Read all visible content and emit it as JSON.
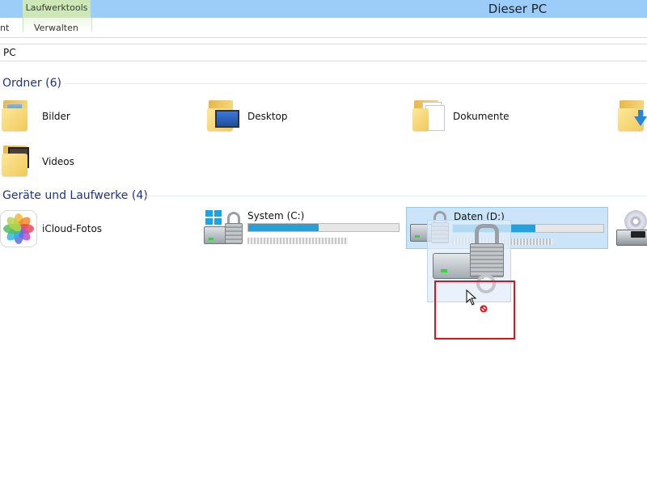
{
  "titlebar": {
    "context_tab_header": "Laufwerktools",
    "title": "Dieser PC"
  },
  "ribbon": {
    "tabs": [
      {
        "label": "nt"
      },
      {
        "label": "Verwalten"
      }
    ]
  },
  "address": {
    "path": "PC"
  },
  "groups": {
    "folders": {
      "header": "Ordner (6)",
      "items": [
        {
          "label": "Bilder",
          "icon": "pictures-folder-icon"
        },
        {
          "label": "Desktop",
          "icon": "desktop-folder-icon"
        },
        {
          "label": "Dokumente",
          "icon": "documents-folder-icon"
        },
        {
          "label": "",
          "icon": "downloads-folder-icon"
        },
        {
          "label": "Videos",
          "icon": "videos-folder-icon"
        }
      ]
    },
    "devices": {
      "header": "Geräte und Laufwerke (4)",
      "items": [
        {
          "label": "iCloud-Fotos",
          "icon": "icloud-photos-icon"
        },
        {
          "label": "System (C:)",
          "icon": "locked-system-drive-icon",
          "usage_fraction": 0.47
        },
        {
          "label": "Daten (D:)",
          "icon": "locked-data-drive-icon",
          "usage_fraction": 0.55
        },
        {
          "label": "",
          "icon": "dvd-drive-icon"
        }
      ]
    }
  },
  "colors": {
    "titlebar": "#9cccf8",
    "context_tab": "#cde8b6",
    "group_header": "#1e3287",
    "drive_fill": "#26a0da",
    "selection": "#cce4f7",
    "highlight": "#cc1b1b"
  },
  "cursor": {
    "icon": "no-drop-cursor-icon"
  }
}
